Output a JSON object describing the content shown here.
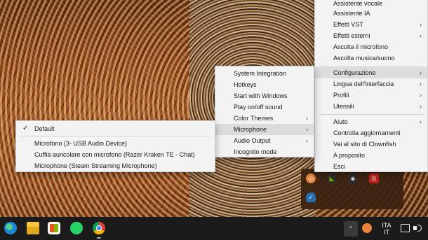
{
  "clownfish_menu": {
    "items": [
      {
        "label": "Assistente vocale"
      },
      {
        "label": "Assistente IA"
      },
      {
        "label": "Effetti VST"
      },
      {
        "label": "Effetti esterni"
      },
      {
        "label": "Ascolta il microfono"
      },
      {
        "label": "Ascolta musica/suono"
      },
      {
        "label": "Configurazione"
      },
      {
        "label": "Lingua dell'interfaccia"
      },
      {
        "label": "Profili"
      },
      {
        "label": "Utensili"
      },
      {
        "label": "Aiuto"
      },
      {
        "label": "Controlla aggiornamenti"
      },
      {
        "label": "Vai al sito di Clownfish"
      },
      {
        "label": "A proposito"
      },
      {
        "label": "Esci"
      }
    ]
  },
  "config_menu": {
    "items": [
      {
        "label": "System Integration"
      },
      {
        "label": "Hotkeys"
      },
      {
        "label": "Start with Windows"
      },
      {
        "label": "Play on/off sound"
      },
      {
        "label": "Color Themes"
      },
      {
        "label": "Microphone"
      },
      {
        "label": "Audio Output"
      },
      {
        "label": "Incognito mode"
      }
    ]
  },
  "mic_menu": {
    "check": "✓",
    "items": [
      {
        "label": "Default"
      },
      {
        "label": "Microfono (3- USB Audio Device)"
      },
      {
        "label": "Cuffia auricolare con microfono (Razer Kraken TE - Chat)"
      },
      {
        "label": "Microphone (Steam Streaming Microphone)"
      }
    ]
  },
  "taskbar": {
    "lang_top": "ITA",
    "lang_bottom": "IT",
    "chevron": "⌃"
  },
  "icons": {
    "chevron_right": "›",
    "chevron_down": "⌄"
  }
}
